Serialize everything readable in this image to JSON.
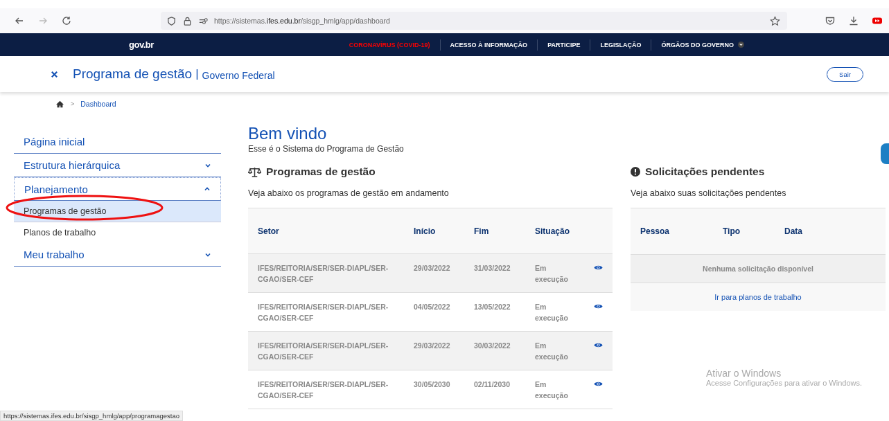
{
  "browser": {
    "url": "https://sistemas.**ifes.edu.br**/sisgp_hmlg/app/dashboard"
  },
  "govbar": {
    "logo": "gov.br",
    "links": [
      {
        "label": "CORONAVÍRUS (COVID-19)",
        "color": "#ff0000",
        "dropdown": false
      },
      {
        "label": "ACESSO À INFORMAÇÃO",
        "color": "#ffffff",
        "dropdown": false
      },
      {
        "label": "PARTICIPE",
        "color": "#ffffff",
        "dropdown": false
      },
      {
        "label": "LEGISLAÇÃO",
        "color": "#ffffff",
        "dropdown": false
      },
      {
        "label": "ÓRGÃOS DO GOVERNO",
        "color": "#ffffff",
        "dropdown": true
      }
    ]
  },
  "header": {
    "title": "Programa de gestão",
    "separator": "|",
    "subtitle": "Governo Federal",
    "button": "Sair"
  },
  "breadcrumb": {
    "separator": ">",
    "current": "Dashboard"
  },
  "sidebar": {
    "items": [
      {
        "label": "Página inicial"
      },
      {
        "label": "Estrutura hierárquica",
        "expanded": false
      },
      {
        "label": "Planejamento",
        "expanded": true,
        "children": [
          {
            "label": "Programas de gestão",
            "selected": true
          },
          {
            "label": "Planos de trabalho",
            "selected": false
          }
        ]
      },
      {
        "label": "Meu trabalho",
        "expanded": false
      }
    ]
  },
  "welcome": {
    "title": "Bem vindo",
    "subtitle": "Esse é o Sistema do Programa de Gestão"
  },
  "programs": {
    "title": "Programas de gestão",
    "description": "Veja abaixo os programas de gestão em andamento",
    "columns": [
      "Setor",
      "Início",
      "Fim",
      "Situação"
    ],
    "rows": [
      {
        "setor": "IFES/REITORIA/SER/SER-DIAPL/SER-CGAO/SER-CEF",
        "inicio": "29/03/2022",
        "fim": "31/03/2022",
        "situacao": "Em execução"
      },
      {
        "setor": "IFES/REITORIA/SER/SER-DIAPL/SER-CGAO/SER-CEF",
        "inicio": "04/05/2022",
        "fim": "13/05/2022",
        "situacao": "Em execução"
      },
      {
        "setor": "IFES/REITORIA/SER/SER-DIAPL/SER-CGAO/SER-CEF",
        "inicio": "29/03/2022",
        "fim": "30/03/2022",
        "situacao": "Em execução"
      },
      {
        "setor": "IFES/REITORIA/SER/SER-DIAPL/SER-CGAO/SER-CEF",
        "inicio": "30/05/2030",
        "fim": "02/11/2030",
        "situacao": "Em execução"
      }
    ]
  },
  "requests": {
    "title": "Solicitações pendentes",
    "description": "Veja abaixo suas solicitações pendentes",
    "columns": [
      "Pessoa",
      "Tipo",
      "Data"
    ],
    "empty": "Nenhuma solicitação disponível",
    "link": "Ir para planos de trabalho"
  },
  "windows_notice": {
    "title": "Ativar o Windows",
    "text": "Acesse Configurações para ativar o Windows."
  },
  "status_bar": {
    "url": "https://sistemas.ifes.edu.br/sisgp_hmlg/app/programagestao"
  }
}
